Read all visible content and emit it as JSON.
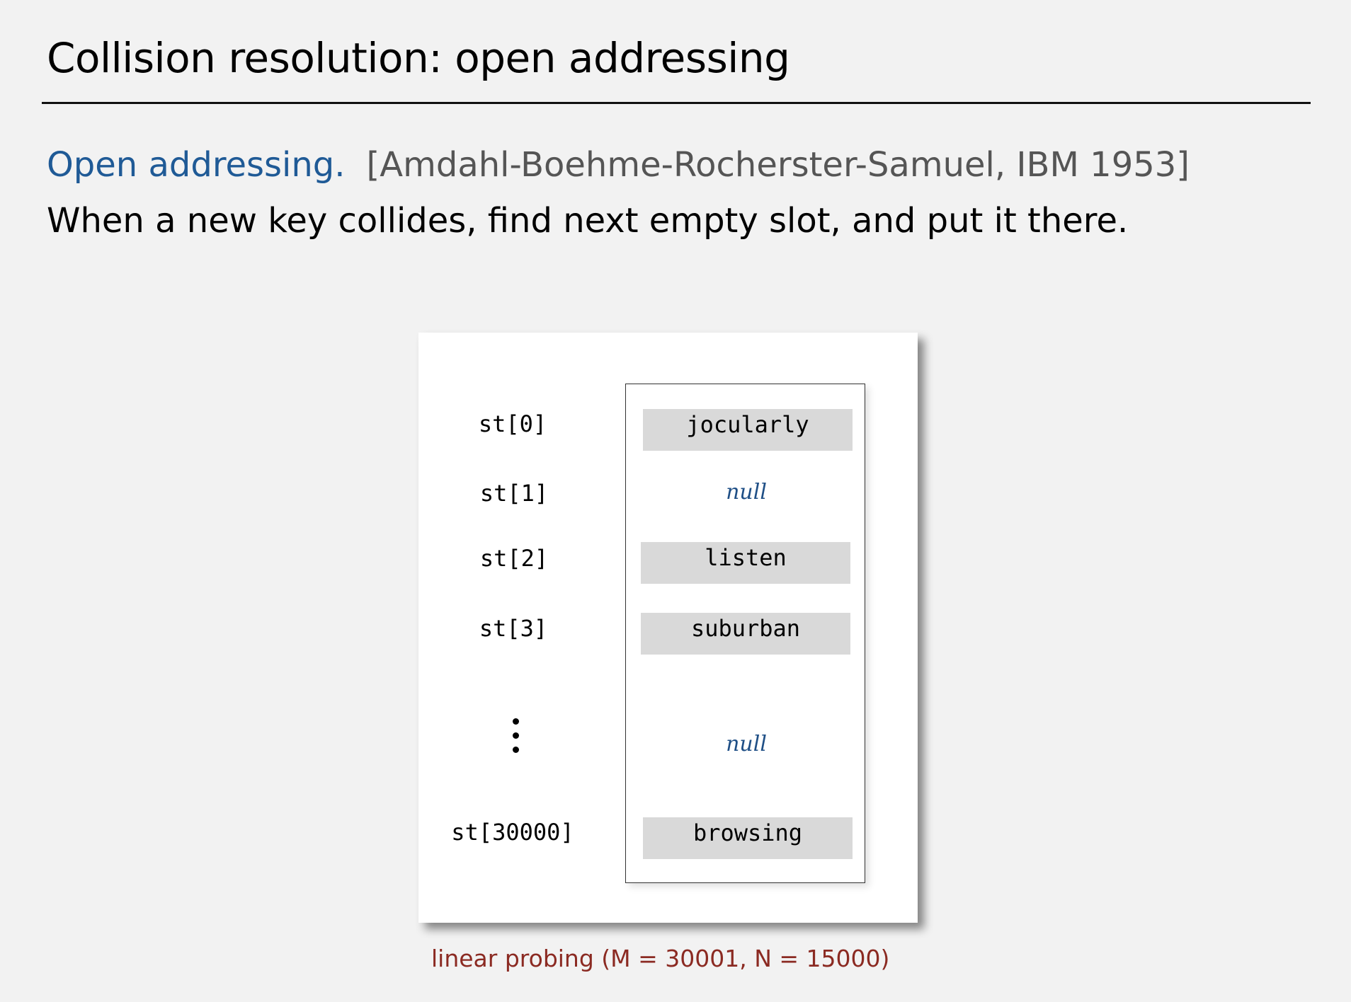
{
  "slide": {
    "title": "Collision resolution:  open addressing",
    "lead_term": "Open addressing.",
    "lead_citation": "[Amdahl-Boehme-Rocherster-Samuel, IBM 1953]",
    "body": "When a new key collides, find next empty slot, and put it there."
  },
  "diagram": {
    "rows": [
      {
        "label": "st[0]",
        "value": "jocularly",
        "is_null": false
      },
      {
        "label": "st[1]",
        "value": "null",
        "is_null": true
      },
      {
        "label": "st[2]",
        "value": "listen",
        "is_null": false
      },
      {
        "label": "st[3]",
        "value": "suburban",
        "is_null": false
      },
      {
        "label": "",
        "value": "null",
        "is_null": true
      },
      {
        "label": "st[30000]",
        "value": "browsing",
        "is_null": false
      }
    ],
    "ellipsis_icon": "vertical-ellipsis",
    "caption": "linear probing (M = 30001, N = 15000)",
    "colors": {
      "cell_fill": "#d9d9d9",
      "null_text": "#1f4f86",
      "caption_text": "#8b2a22",
      "lead_term": "#1f5a96"
    }
  }
}
